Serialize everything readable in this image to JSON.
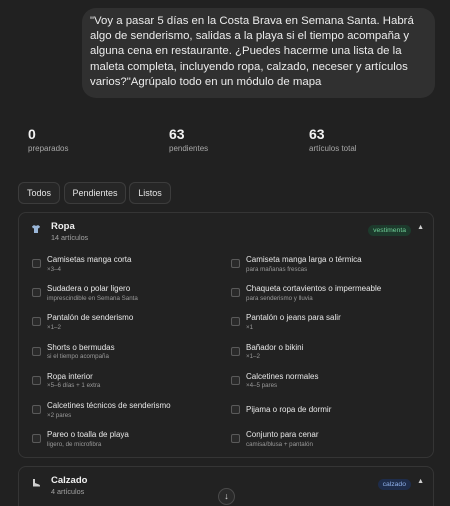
{
  "message": {
    "text": "\"Voy a pasar 5 días en la Costa Brava en Semana Santa. Habrá algo de senderismo, salidas a la playa si el tiempo acompaña y alguna cena en restaurante. ¿Puedes hacerme una lista de la maleta completa, incluyendo ropa, calzado, neceser y artículos varios?\"Agrúpalo todo en un módulo de mapa"
  },
  "stats": [
    {
      "value": "0",
      "label": "preparados"
    },
    {
      "value": "63",
      "label": "pendientes"
    },
    {
      "value": "63",
      "label": "artículos total"
    }
  ],
  "filters": [
    "Todos",
    "Pendientes",
    "Listos"
  ],
  "categories": [
    {
      "icon": "shirt-icon",
      "title": "Ropa",
      "count": "14 artículos",
      "tag": "vestimenta",
      "tag_color": "#6fcf97",
      "items": [
        {
          "name": "Camisetas manga corta",
          "note": "×3–4"
        },
        {
          "name": "Camiseta manga larga o térmica",
          "note": "para mañanas frescas"
        },
        {
          "name": "Sudadera o polar ligero",
          "note": "imprescindible en Semana Santa"
        },
        {
          "name": "Chaqueta cortavientos o impermeable",
          "note": "para senderismo y lluvia"
        },
        {
          "name": "Pantalón de senderismo",
          "note": "×1–2"
        },
        {
          "name": "Pantalón o jeans para salir",
          "note": "×1"
        },
        {
          "name": "Shorts o bermudas",
          "note": "si el tiempo acompaña"
        },
        {
          "name": "Bañador o bikini",
          "note": "×1–2"
        },
        {
          "name": "Ropa interior",
          "note": "×5–6 días + 1 extra"
        },
        {
          "name": "Calcetines normales",
          "note": "×4–5 pares"
        },
        {
          "name": "Calcetines técnicos de senderismo",
          "note": "×2 pares"
        },
        {
          "name": "Pijama o ropa de dormir",
          "note": ""
        },
        {
          "name": "Pareo o toalla de playa",
          "note": "ligero, de microfibra"
        },
        {
          "name": "Conjunto para cenar",
          "note": "camisa/blusa + pantalón"
        }
      ]
    },
    {
      "icon": "shoe-icon",
      "title": "Calzado",
      "count": "4 artículos",
      "tag": "calzado",
      "tag_color": "#8fb0ea",
      "items": []
    }
  ],
  "scroll_button": {
    "icon": "arrow-down-icon",
    "glyph": "↓"
  }
}
